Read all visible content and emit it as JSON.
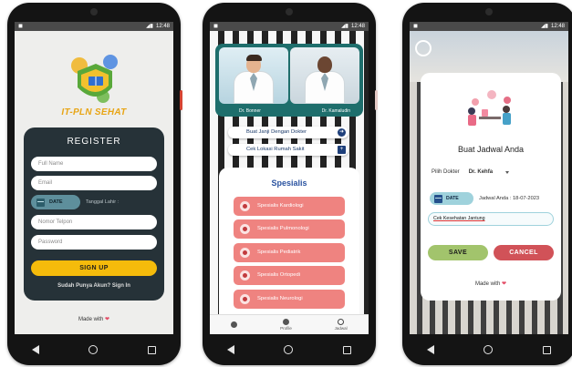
{
  "status_bar": {
    "time": "12:48"
  },
  "register_screen": {
    "logo_text": "IT-PLN SEHAT",
    "title": "REGISTER",
    "fields": [
      "Full Name",
      "Email"
    ],
    "date_button": "DATE",
    "date_label": "Tanggal Lahir :",
    "fields2": [
      "Nomor Telpon",
      "Password"
    ],
    "signup_label": "SIGN UP",
    "signin_link": "Sudah Punya Akun? Sign In",
    "made_with": "Made with",
    "heart": "❤"
  },
  "home_screen": {
    "doctors": [
      {
        "name": "Dr. Bonner"
      },
      {
        "name": "Dr. Kamaludin"
      }
    ],
    "actions": [
      {
        "label": "Buat Janji Dengan Dokter",
        "icon": "arrow-right-circle-icon"
      },
      {
        "label": "Cek Lokasi Rumah Sakit",
        "icon": "plus-square-icon"
      }
    ],
    "spesialis_title": "Spesialis",
    "spesialis": [
      "Spesialis Kardiologi",
      "Spesialis Pulmonologi",
      "Spesialis Pediatrik",
      "Spesialis Ortopedi",
      "Spesialis Neurologi"
    ],
    "tabs": [
      {
        "label": "",
        "icon": "home-icon"
      },
      {
        "label": "Profile",
        "icon": "info-icon"
      },
      {
        "label": "Jadwal",
        "icon": "clock-icon"
      }
    ]
  },
  "schedule_screen": {
    "title": "Buat Jadwal Anda",
    "pick_label": "Pilih Dokter",
    "pick_value": "Dr. Kehfa",
    "date_button": "DATE",
    "jadwal_text": "Jadwal Anda : 18-07-2023",
    "keluhan_value": "Cek Kesehatan Jantung",
    "save_label": "SAVE",
    "cancel_label": "CANCEL",
    "made_with": "Made with",
    "heart": "❤"
  },
  "colors": {
    "register_card": "#263238",
    "accent_yellow": "#f5bb0b",
    "spec_item": "#ef8380",
    "save_green": "#a2c46c",
    "cancel_red": "#d15258"
  }
}
